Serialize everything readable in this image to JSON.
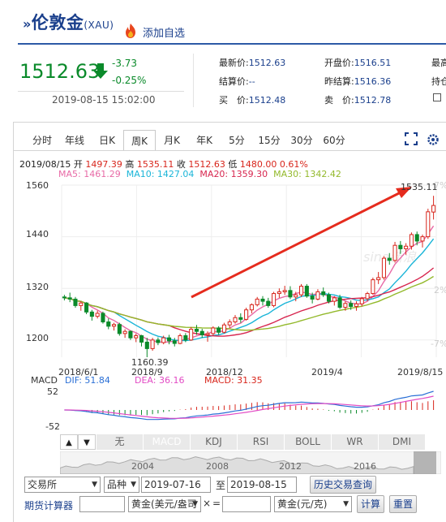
{
  "header": {
    "title": "伦敦金",
    "code": "(XAU)",
    "watch_label": "添加自选"
  },
  "quote": {
    "price": "1512.63",
    "change": "-3.73",
    "change_pct": "-0.25%",
    "time": "2019-08-15 15:02:00",
    "fields": [
      {
        "label": "最新价:",
        "value": "1512.63"
      },
      {
        "label": "开盘价:",
        "value": "1516.51"
      },
      {
        "label": "最高",
        "value": ""
      },
      {
        "label": "结算价:",
        "value": "--"
      },
      {
        "label": "昨结算:",
        "value": "1516.36"
      },
      {
        "label": "持仓",
        "value": ""
      },
      {
        "label": "买　价:",
        "value": "1512.48"
      },
      {
        "label": "卖　价:",
        "value": "1512.78"
      }
    ]
  },
  "tabs": [
    "分时",
    "年线",
    "日K",
    "周K",
    "月K",
    "年K",
    "5分",
    "15分",
    "30分",
    "60分"
  ],
  "active_tab": "周K",
  "ohlc_line": {
    "date": "2019/08/15",
    "open_label": "开",
    "open": "1497.39",
    "high_label": "高",
    "high": "1535.11",
    "close_label": "收",
    "close": "1512.63",
    "low_label": "低",
    "low": "1480.00",
    "pct": "0.61%"
  },
  "ma_line": {
    "ma5": "MA5: 1461.29",
    "ma10": "MA10: 1427.04",
    "ma20": "MA20: 1359.30",
    "ma30": "MA30: 1342.42"
  },
  "colors": {
    "up": "#d8261c",
    "down": "#0a8a2a",
    "ma5": "#e86aa6",
    "ma10": "#1ab5d8",
    "ma20": "#d7264f",
    "ma30": "#93b92b",
    "brand": "#1a3f8c",
    "dif": "#2a6fd6",
    "dea": "#e24ac4"
  },
  "chart_data": [
    {
      "type": "candlestick",
      "ylim": [
        1160,
        1560
      ],
      "y_ticks": [
        "1560",
        "1440",
        "1320",
        "1200"
      ],
      "x_ticks": [
        "2018/6/1",
        "2018/9",
        "2018/12",
        "2019/4",
        "2019/8/15"
      ],
      "pct_ticks": [
        "7%",
        "2%",
        "-7%"
      ],
      "annotations": {
        "max": "1535.11",
        "min": "1160.39"
      },
      "watermark": "sina新浪",
      "candles": [
        [
          1300,
          1305,
          1292,
          1298
        ],
        [
          1298,
          1310,
          1288,
          1295
        ],
        [
          1295,
          1300,
          1275,
          1280
        ],
        [
          1280,
          1290,
          1268,
          1286
        ],
        [
          1286,
          1288,
          1260,
          1265
        ],
        [
          1265,
          1270,
          1245,
          1255
        ],
        [
          1255,
          1268,
          1250,
          1262
        ],
        [
          1262,
          1266,
          1238,
          1242
        ],
        [
          1242,
          1250,
          1225,
          1232
        ],
        [
          1232,
          1240,
          1222,
          1236
        ],
        [
          1236,
          1240,
          1210,
          1215
        ],
        [
          1215,
          1225,
          1205,
          1220
        ],
        [
          1220,
          1222,
          1200,
          1205
        ],
        [
          1205,
          1215,
          1195,
          1210
        ],
        [
          1210,
          1212,
          1185,
          1195
        ],
        [
          1195,
          1205,
          1160,
          1180
        ],
        [
          1180,
          1205,
          1175,
          1200
        ],
        [
          1200,
          1206,
          1188,
          1194
        ],
        [
          1194,
          1210,
          1190,
          1205
        ],
        [
          1205,
          1212,
          1190,
          1198
        ],
        [
          1198,
          1205,
          1185,
          1192
        ],
        [
          1192,
          1215,
          1190,
          1210
        ],
        [
          1210,
          1216,
          1195,
          1200
        ],
        [
          1200,
          1230,
          1198,
          1225
        ],
        [
          1225,
          1235,
          1212,
          1220
        ],
        [
          1220,
          1226,
          1205,
          1212
        ],
        [
          1212,
          1220,
          1196,
          1215
        ],
        [
          1215,
          1232,
          1210,
          1228
        ],
        [
          1228,
          1232,
          1212,
          1218
        ],
        [
          1218,
          1240,
          1215,
          1235
        ],
        [
          1235,
          1248,
          1228,
          1242
        ],
        [
          1242,
          1258,
          1238,
          1252
        ],
        [
          1252,
          1262,
          1240,
          1248
        ],
        [
          1248,
          1275,
          1245,
          1270
        ],
        [
          1270,
          1285,
          1262,
          1282
        ],
        [
          1282,
          1300,
          1278,
          1295
        ],
        [
          1295,
          1302,
          1280,
          1290
        ],
        [
          1290,
          1298,
          1275,
          1280
        ],
        [
          1280,
          1312,
          1276,
          1308
        ],
        [
          1308,
          1320,
          1298,
          1312
        ],
        [
          1312,
          1326,
          1305,
          1315
        ],
        [
          1315,
          1325,
          1295,
          1300
        ],
        [
          1300,
          1312,
          1290,
          1305
        ],
        [
          1305,
          1330,
          1300,
          1325
        ],
        [
          1325,
          1330,
          1298,
          1302
        ],
        [
          1302,
          1310,
          1285,
          1295
        ],
        [
          1295,
          1318,
          1292,
          1312
        ],
        [
          1312,
          1322,
          1300,
          1305
        ],
        [
          1305,
          1310,
          1285,
          1290
        ],
        [
          1290,
          1302,
          1280,
          1298
        ],
        [
          1298,
          1305,
          1272,
          1276
        ],
        [
          1276,
          1290,
          1268,
          1285
        ],
        [
          1285,
          1292,
          1270,
          1278
        ],
        [
          1278,
          1290,
          1268,
          1284
        ],
        [
          1284,
          1300,
          1278,
          1296
        ],
        [
          1296,
          1312,
          1290,
          1308
        ],
        [
          1308,
          1345,
          1305,
          1340
        ],
        [
          1340,
          1358,
          1330,
          1345
        ],
        [
          1345,
          1395,
          1340,
          1390
        ],
        [
          1390,
          1402,
          1375,
          1385
        ],
        [
          1385,
          1428,
          1380,
          1420
        ],
        [
          1420,
          1430,
          1400,
          1412
        ],
        [
          1412,
          1425,
          1398,
          1418
        ],
        [
          1418,
          1450,
          1410,
          1445
        ],
        [
          1445,
          1452,
          1420,
          1430
        ],
        [
          1430,
          1445,
          1415,
          1440
        ],
        [
          1440,
          1505,
          1435,
          1498
        ],
        [
          1497.39,
          1535.11,
          1480,
          1512.63
        ]
      ]
    },
    {
      "type": "bar",
      "name": "MACD",
      "ylim": [
        -52,
        52
      ],
      "y_ticks": [
        "52",
        "-52"
      ],
      "legend": {
        "dif": "DIF: 51.84",
        "dea": "DEA: 36.16",
        "macd": "MACD: 31.35"
      }
    },
    {
      "type": "area",
      "x_ticks": [
        "2004",
        "2008",
        "2012",
        "2016"
      ]
    }
  ],
  "indicators": {
    "nav_left": "▲",
    "nav_right": "▼",
    "items": [
      "无",
      "MACD",
      "KDJ",
      "RSI",
      "BOLL",
      "WR",
      "DMI"
    ],
    "selected": "MACD"
  },
  "form": {
    "exchange": "交易所",
    "variety": "品种",
    "start_date": "2019-07-16",
    "to_label": "至",
    "end_date": "2019-08-15",
    "history_button": "历史交易查询",
    "calc_label": "期货计算器",
    "unit_from": "黄金(美元/盎司",
    "multiply": "×",
    "equals": "=",
    "unit_to": "黄金(元/克)",
    "calc_button": "计算",
    "reset_button": "重置"
  }
}
